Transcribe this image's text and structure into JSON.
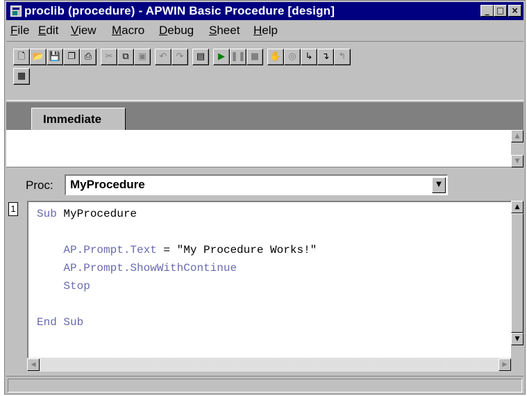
{
  "window": {
    "title": "proclib (procedure) - APWIN Basic Procedure [design]",
    "controls": {
      "minimize": "_",
      "maximize": "□",
      "close": "×"
    }
  },
  "menu": [
    {
      "label": "File",
      "key": "F",
      "rest": "ile"
    },
    {
      "label": "Edit",
      "key": "E",
      "rest": "dit"
    },
    {
      "label": "View",
      "key": "V",
      "rest": "iew"
    },
    {
      "label": "Macro",
      "key": "M",
      "rest": "acro"
    },
    {
      "label": "Debug",
      "key": "D",
      "rest": "ebug"
    },
    {
      "label": "Sheet",
      "key": "S",
      "rest": "heet"
    },
    {
      "label": "Help",
      "key": "H",
      "rest": "elp"
    }
  ],
  "toolbar": {
    "buttons": [
      {
        "name": "new-icon",
        "glyph": "🗋",
        "enabled": true
      },
      {
        "name": "open-icon",
        "glyph": "📂",
        "enabled": true
      },
      {
        "name": "save-icon",
        "glyph": "💾",
        "enabled": false
      },
      {
        "name": "save-all-icon",
        "glyph": "❐",
        "enabled": true
      },
      {
        "name": "print-icon",
        "glyph": "⎙",
        "enabled": true
      },
      {
        "name": "cut-icon",
        "glyph": "✂",
        "enabled": false
      },
      {
        "name": "copy-icon",
        "glyph": "⧉",
        "enabled": true
      },
      {
        "name": "paste-icon",
        "glyph": "▣",
        "enabled": false
      },
      {
        "name": "undo-icon",
        "glyph": "↶",
        "enabled": false
      },
      {
        "name": "redo-icon",
        "glyph": "↷",
        "enabled": false
      },
      {
        "name": "dialog-editor-icon",
        "glyph": "▤",
        "enabled": true
      },
      {
        "name": "run-icon",
        "glyph": "▶",
        "enabled": true,
        "color": "#008000"
      },
      {
        "name": "pause-icon",
        "glyph": "❚❚",
        "enabled": false
      },
      {
        "name": "stop-icon",
        "glyph": "■",
        "enabled": false
      },
      {
        "name": "hand-toggle-breakpoint-icon",
        "glyph": "✋",
        "enabled": true
      },
      {
        "name": "quick-watch-icon",
        "glyph": "◎",
        "enabled": false
      },
      {
        "name": "step-into-icon",
        "glyph": "↳",
        "enabled": true
      },
      {
        "name": "step-over-icon",
        "glyph": "↴",
        "enabled": true
      },
      {
        "name": "step-out-icon",
        "glyph": "↰",
        "enabled": false
      },
      {
        "name": "object-browser-icon",
        "glyph": "▦",
        "enabled": true
      }
    ]
  },
  "immediate": {
    "tab_label": "Immediate",
    "scroll_up": "▲",
    "scroll_down": "▼"
  },
  "proc": {
    "label": "Proc:",
    "value": "MyProcedure",
    "dropdown_glyph": "▼"
  },
  "editor": {
    "line_number": "1",
    "lines": [
      {
        "parts": [
          {
            "t": "Sub ",
            "c": "kw"
          },
          {
            "t": "MyProcedure",
            "c": "id"
          }
        ]
      },
      {
        "parts": []
      },
      {
        "parts": [
          {
            "t": "    AP.Prompt.Text",
            "c": "kw"
          },
          {
            "t": " = \"My Procedure Works!\"",
            "c": "str"
          }
        ]
      },
      {
        "parts": [
          {
            "t": "    AP.Prompt.ShowWithContinue",
            "c": "kw"
          }
        ]
      },
      {
        "parts": [
          {
            "t": "    Stop",
            "c": "kw"
          }
        ]
      },
      {
        "parts": []
      },
      {
        "parts": [
          {
            "t": "End Sub",
            "c": "kw"
          }
        ]
      }
    ],
    "scroll_up": "▲",
    "scroll_down": "▼",
    "scroll_left": "◀",
    "scroll_right": "▶"
  },
  "statusbar": {
    "text": ""
  }
}
